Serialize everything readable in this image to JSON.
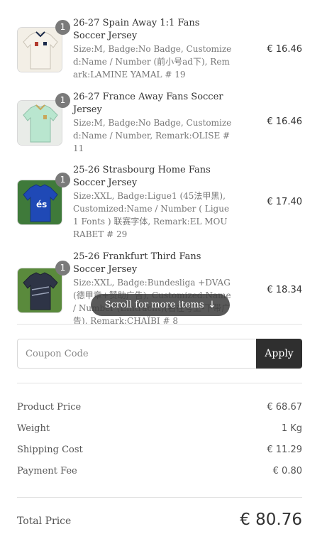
{
  "items": [
    {
      "qty": "1",
      "name": "26-27 Spain Away 1:1 Fans Soccer Jersey",
      "variant": "Size:M, Badge:No Badge, Customized:Name / Number (前小号ad下), Remark:LAMINE YAMAL # 19",
      "price": "€ 16.46",
      "colors": {
        "bg": "#f3efe6",
        "shirt": "#f6f2ea",
        "accent": "#1b2a4a"
      }
    },
    {
      "qty": "1",
      "name": "26-27 France Away Fans Soccer Jersey",
      "variant": "Size:M, Badge:No Badge, Customized:Name / Number, Remark:OLISE # 11",
      "price": "€ 16.46",
      "colors": {
        "bg": "#e9ece8",
        "shirt": "#b9e6cf",
        "accent": "#c8a75a"
      }
    },
    {
      "qty": "1",
      "name": "25-26 Strasbourg Home Fans Soccer Jersey",
      "variant": "Size:XXL, Badge:Ligue1 (45法甲黑), Customized:Name / Number ( Ligue1 Fonts ) 联赛字体, Remark:EL MOURABET # 29",
      "price": "€ 17.40",
      "colors": {
        "bg": "#3f7a3a",
        "shirt": "#1f49b6",
        "accent": "#ffffff"
      }
    },
    {
      "qty": "1",
      "name": "25-26 Frankfurt Third Fans Soccer Jersey",
      "variant": "Size:XXL, Badge:Bundesliga +DVAG (德甲章+赞助广告), Customized:Name / Number (Eintracht)(名在号上-下带广告), Remark:CHAÏBI # 8",
      "price": "€ 18.34",
      "colors": {
        "bg": "#5a8a3c",
        "shirt": "#2e3446",
        "accent": "#9aa3b8"
      }
    }
  ],
  "scroll_hint": {
    "label": "Scroll for more items",
    "icon": "arrow-down-icon",
    "glyph": "↓"
  },
  "coupon": {
    "placeholder": "Coupon Code",
    "value": "",
    "apply_label": "Apply"
  },
  "summary": [
    {
      "label": "Product Price",
      "value": "€ 68.67"
    },
    {
      "label": "Weight",
      "value": "1 Kg"
    },
    {
      "label": "Shipping Cost",
      "value": "€ 11.29"
    },
    {
      "label": "Payment Fee",
      "value": "€ 0.80"
    }
  ],
  "total": {
    "label": "Total Price",
    "value": "€ 80.76"
  }
}
